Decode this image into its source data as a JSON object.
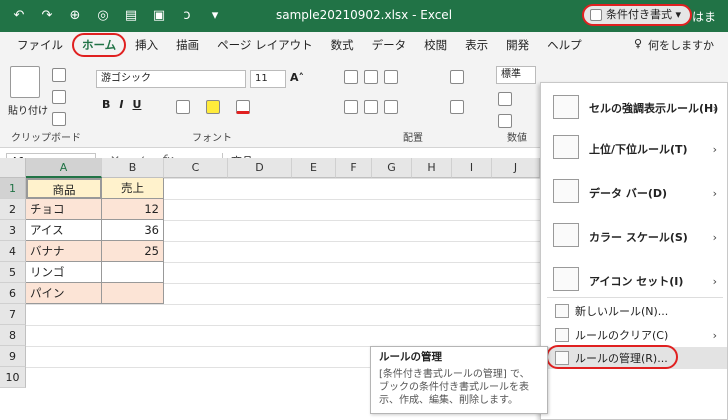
{
  "titlebar": {
    "quick_access": [
      "↶",
      "↷",
      "⊕",
      "◎",
      "▤",
      "▣",
      "ↄ",
      "▾"
    ],
    "title": "sample20210902.xlsx  -  Excel",
    "user": "はま"
  },
  "menubar": {
    "tabs": [
      "ファイル",
      "ホーム",
      "挿入",
      "描画",
      "ページ レイアウト",
      "数式",
      "データ",
      "校閲",
      "表示",
      "開発",
      "ヘルプ"
    ],
    "tell_me": "何をしますか"
  },
  "ribbon": {
    "clipboard": {
      "paste": "貼り付け",
      "label": "クリップボード"
    },
    "font": {
      "name": "游ゴシック",
      "size": "11",
      "label": "フォント",
      "buttons": [
        "B",
        "I",
        "U"
      ]
    },
    "alignment": {
      "label": "配置"
    },
    "number": {
      "format": "標準",
      "label": "数値"
    },
    "conditional_formatting": "条件付き書式"
  },
  "formula_bar": {
    "name_box": "A1",
    "fx": "fx",
    "value": "商品"
  },
  "sheet": {
    "columns": [
      "A",
      "B",
      "C",
      "D",
      "E",
      "F",
      "G",
      "H",
      "I",
      "J"
    ],
    "rows": [
      "1",
      "2",
      "3",
      "4",
      "5",
      "6",
      "7",
      "8",
      "9",
      "10"
    ],
    "header": [
      "商品",
      "売上"
    ],
    "data": [
      [
        "チョコ",
        "12"
      ],
      [
        "アイス",
        "36"
      ],
      [
        "バナナ",
        "25"
      ],
      [
        "リンゴ",
        ""
      ],
      [
        "パイン",
        ""
      ]
    ]
  },
  "cf_menu": {
    "items": [
      {
        "label": "セルの強調表示ルール(H)",
        "icon": "highlight-rules-icon"
      },
      {
        "label": "上位/下位ルール(T)",
        "icon": "top-bottom-icon"
      },
      {
        "label": "データ バー(D)",
        "icon": "data-bars-icon"
      },
      {
        "label": "カラー スケール(S)",
        "icon": "color-scales-icon"
      },
      {
        "label": "アイコン セット(I)",
        "icon": "icon-sets-icon"
      }
    ],
    "small_items": [
      {
        "label": "新しいルール(N)...",
        "icon": "new-rule-icon"
      },
      {
        "label": "ルールのクリア(C)",
        "icon": "clear-rules-icon"
      },
      {
        "label": "ルールの管理(R)...",
        "icon": "manage-rules-icon"
      }
    ]
  },
  "tooltip": {
    "title": "ルールの管理",
    "body": "[条件付き書式ルールの管理] で、ブックの条件付き書式ルールを表示、作成、編集、削除します。"
  },
  "colors": {
    "accent": "#217346",
    "highlight": "#e02020",
    "header_fill": "#fce4d6",
    "header_cell": "#fff2cc"
  }
}
